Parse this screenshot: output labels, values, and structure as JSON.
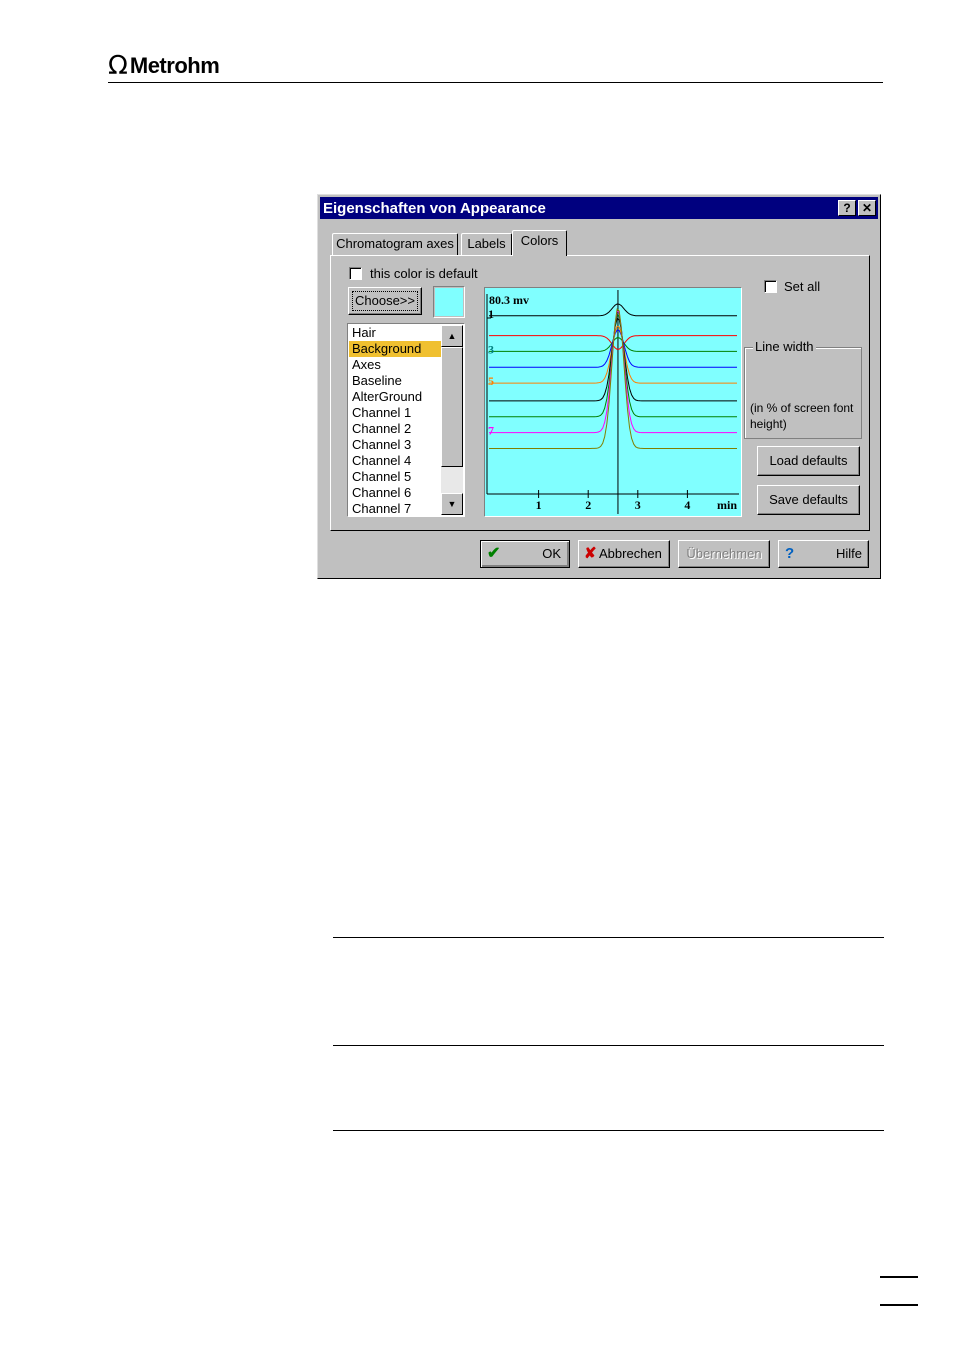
{
  "header": {
    "logo_text": "Metrohm",
    "logo_symbol": "Ω"
  },
  "dialog": {
    "title": "Eigenschaften von Appearance",
    "help_button": "?",
    "close_button": "✕",
    "tabs": [
      {
        "label": "Chromatogram axes",
        "active": false
      },
      {
        "label": "Labels",
        "active": false
      },
      {
        "label": "Colors",
        "active": true
      }
    ],
    "default_checkbox_label": "this color is default",
    "choose_button": "Choose>>",
    "swatch_color": "#80ffff",
    "color_items": [
      "Hair",
      "Background",
      "Axes",
      "Baseline",
      "AlterGround",
      "Channel 1",
      "Channel 2",
      "Channel 3",
      "Channel 4",
      "Channel 5",
      "Channel 6",
      "Channel 7"
    ],
    "selected_item": "Background",
    "set_all_label": "Set all",
    "line_width": {
      "legend": "Line width",
      "note": "(in % of screen font height)"
    },
    "load_defaults": "Load defaults",
    "save_defaults": "Save defaults",
    "footer": {
      "ok": "OK",
      "cancel": "Abbrechen",
      "apply": "Übernehmen",
      "help": "Hilfe"
    }
  },
  "chart_data": {
    "type": "line",
    "title": "80.3 mv",
    "background": "#80ffff",
    "x_ticks": [
      "1",
      "2",
      "3",
      "4"
    ],
    "x_unit": "min",
    "channel_labels": [
      {
        "label": "1",
        "color": "#000000"
      },
      {
        "label": "3",
        "color": "#008080"
      },
      {
        "label": "5",
        "color": "#ff8000"
      },
      {
        "label": "7",
        "color": "#ff00ff"
      }
    ],
    "series": [
      {
        "color": "#000000",
        "baseline": 0.9,
        "peak": 0.05
      },
      {
        "color": "#ff0000",
        "baseline": 0.8,
        "peak": 0.28
      },
      {
        "color": "#008000",
        "baseline": 0.72,
        "peak": 0.22
      },
      {
        "color": "#0000ff",
        "baseline": 0.64,
        "peak": 0.18
      },
      {
        "color": "#ff8000",
        "baseline": 0.56,
        "peak": 0.16
      },
      {
        "color": "#000000",
        "baseline": 0.47,
        "peak": 0.12
      },
      {
        "color": "#008000",
        "baseline": 0.39,
        "peak": 0.1
      },
      {
        "color": "#ff00ff",
        "baseline": 0.31,
        "peak": 0.08
      },
      {
        "color": "#808000",
        "baseline": 0.23,
        "peak": 0.07
      }
    ],
    "peak_x": 2.6,
    "xlim": [
      0.0,
      5.0
    ]
  }
}
